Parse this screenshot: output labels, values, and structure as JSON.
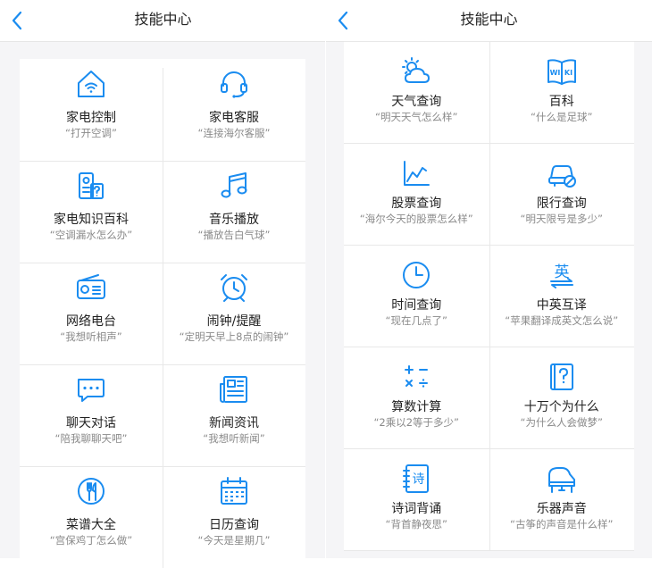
{
  "colors": {
    "accent": "#1a8cf0",
    "text": "#222222",
    "hint": "#8a8a8a"
  },
  "left_screen": {
    "title": "技能中心",
    "back_icon": "chevron-left-icon",
    "skills": [
      {
        "icon": "home-wifi-icon",
        "name": "家电控制",
        "hint": "“打开空调”"
      },
      {
        "icon": "headset-icon",
        "name": "家电客服",
        "hint": "“连接海尔客服”"
      },
      {
        "icon": "appliance-book-icon",
        "name": "家电知识百科",
        "hint": "“空调漏水怎么办”"
      },
      {
        "icon": "music-note-icon",
        "name": "音乐播放",
        "hint": "“播放告白气球”"
      },
      {
        "icon": "radio-icon",
        "name": "网络电台",
        "hint": "“我想听相声”"
      },
      {
        "icon": "alarm-clock-icon",
        "name": "闹钟/提醒",
        "hint": "“定明天早上8点的闹钟”"
      },
      {
        "icon": "chat-bubble-icon",
        "name": "聊天对话",
        "hint": "“陪我聊聊天吧”"
      },
      {
        "icon": "newspaper-icon",
        "name": "新闻资讯",
        "hint": "“我想听新闻”"
      },
      {
        "icon": "utensils-icon",
        "name": "菜谱大全",
        "hint": "“宫保鸡丁怎么做”"
      },
      {
        "icon": "calendar-icon",
        "name": "日历查询",
        "hint": "“今天是星期几”"
      }
    ]
  },
  "right_screen": {
    "title": "技能中心",
    "back_icon": "chevron-left-icon",
    "skills": [
      {
        "icon": "weather-icon",
        "name": "天气查询",
        "hint": "“明天天气怎么样”"
      },
      {
        "icon": "wiki-book-icon",
        "name": "百科",
        "hint": "“什么是足球”"
      },
      {
        "icon": "stock-chart-icon",
        "name": "股票查询",
        "hint": "“海尔今天的股票怎么样”"
      },
      {
        "icon": "car-restriction-icon",
        "name": "限行查询",
        "hint": "“明天限号是多少”"
      },
      {
        "icon": "clock-icon",
        "name": "时间查询",
        "hint": "“现在几点了”"
      },
      {
        "icon": "translate-icon",
        "name": "中英互译",
        "hint": "“苹果翻译成英文怎么说”"
      },
      {
        "icon": "calculator-icon",
        "name": "算数计算",
        "hint": "“2乘以2等于多少”"
      },
      {
        "icon": "question-book-icon",
        "name": "十万个为什么",
        "hint": "“为什么人会做梦”"
      },
      {
        "icon": "poem-icon",
        "name": "诗词背诵",
        "hint": "“背首静夜思”"
      },
      {
        "icon": "piano-icon",
        "name": "乐器声音",
        "hint": "“古筝的声音是什么样”"
      }
    ]
  },
  "icon_text": {
    "wiki_w": "WI",
    "wiki_k": "KI",
    "poem": "诗",
    "translate": "英"
  }
}
